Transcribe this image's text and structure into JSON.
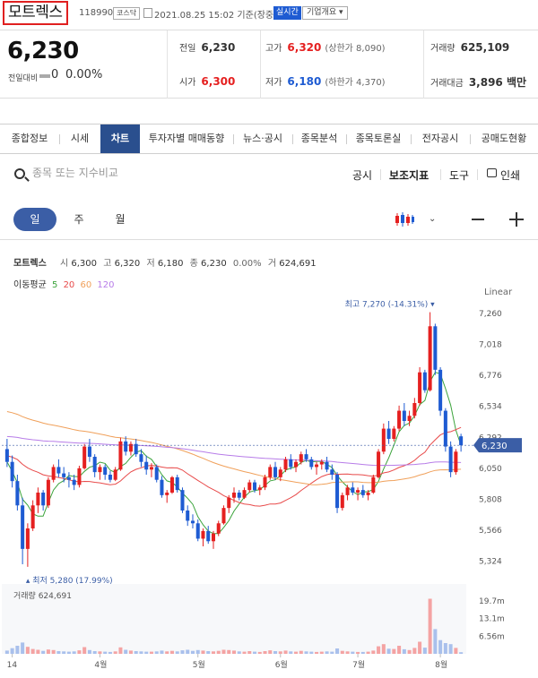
{
  "header": {
    "stock_name": "모트렉스",
    "code": "118990",
    "market": "코스닥",
    "datetime": "2021.08.25 15:02 기준(장중)",
    "realtime": "실시간",
    "company_button": "기업개요 ▾"
  },
  "price": {
    "current": "6,230",
    "change_label": "전일대비",
    "change_value": "0",
    "change_rate": "0.00%"
  },
  "stats": {
    "prev_close_label": "전일",
    "prev_close": "6,230",
    "high_label": "고가",
    "high": "6,320",
    "upper_limit": "(상한가 8,090)",
    "volume_label": "거래량",
    "volume": "625,109",
    "open_label": "시가",
    "open": "6,300",
    "low_label": "저가",
    "low": "6,180",
    "lower_limit": "(하한가 4,370)",
    "amount_label": "거래대금",
    "amount": "3,896 백만"
  },
  "tabs": [
    "종합정보",
    "시세",
    "차트",
    "투자자별 매매동향",
    "뉴스·공시",
    "종목분석",
    "종목토론실",
    "전자공시",
    "공매도현황"
  ],
  "toolbar": {
    "search_placeholder": "종목 또는 지수비교",
    "disclosure": "공시",
    "indicators": "보조지표",
    "tools": "도구",
    "print": "인쇄"
  },
  "periods": [
    "일",
    "주",
    "월"
  ],
  "chart_info": {
    "name": "모트렉스",
    "open_label": "시",
    "open": "6,300",
    "high_label": "고",
    "high": "6,320",
    "low_label": "저",
    "low": "6,180",
    "close_label": "종",
    "close": "6,230",
    "rate": "0.00%",
    "volume_label": "거",
    "volume": "624,691",
    "ma_label": "이동평균",
    "ma5": "5",
    "ma20": "20",
    "ma60": "60",
    "ma120": "120",
    "scale": "Linear"
  },
  "colors": {
    "up": "#e52020",
    "down": "#1e5bd2",
    "ma5": "#3aa33a",
    "ma20": "#e84a4a",
    "ma60": "#f0a05a",
    "ma120": "#b77ce8",
    "accent": "#2a4f8e"
  },
  "chart_data": {
    "type": "candlestick",
    "x_labels": [
      "14",
      "4월",
      "5월",
      "6월",
      "7월",
      "8월"
    ],
    "y_ticks": [
      "7,260",
      "7,018",
      "6,776",
      "6,534",
      "6,292",
      "6,050",
      "5,808",
      "5,566",
      "5,324"
    ],
    "y_range": [
      5230,
      7330
    ],
    "current_price": 6230,
    "current_price_label": "6,230",
    "max_label": "최고 7,270 (-14.31%)",
    "min_label": "최저 5,280 (17.99%)",
    "volume_label": "거래량",
    "volume_value": "624,691",
    "volume_ticks": [
      "19.7m",
      "13.1m",
      "6.56m"
    ],
    "volume_max": 26000000,
    "candles": [
      [
        6200,
        6280,
        6060,
        6100
      ],
      [
        6100,
        6150,
        5900,
        5950
      ],
      [
        5950,
        6000,
        5720,
        5760
      ],
      [
        5760,
        5820,
        5300,
        5420
      ],
      [
        5420,
        5620,
        5280,
        5580
      ],
      [
        5580,
        5800,
        5560,
        5760
      ],
      [
        5760,
        5900,
        5700,
        5860
      ],
      [
        5860,
        5880,
        5720,
        5760
      ],
      [
        5760,
        5980,
        5740,
        5960
      ],
      [
        5960,
        6080,
        5940,
        6060
      ],
      [
        6060,
        6120,
        5980,
        6010
      ],
      [
        6010,
        6060,
        5940,
        5980
      ],
      [
        5980,
        6020,
        5900,
        5960
      ],
      [
        5960,
        6000,
        5880,
        5920
      ],
      [
        5920,
        6070,
        5900,
        6050
      ],
      [
        6050,
        6240,
        6040,
        6220
      ],
      [
        6220,
        6280,
        6100,
        6140
      ],
      [
        6140,
        6160,
        5980,
        6020
      ],
      [
        6020,
        6080,
        5960,
        6060
      ],
      [
        6060,
        6080,
        5960,
        6000
      ],
      [
        6000,
        6030,
        5940,
        5960
      ],
      [
        5960,
        6060,
        5950,
        6040
      ],
      [
        6040,
        6290,
        6030,
        6260
      ],
      [
        6260,
        6300,
        6150,
        6180
      ],
      [
        6180,
        6260,
        6150,
        6240
      ],
      [
        6240,
        6280,
        6140,
        6160
      ],
      [
        6160,
        6200,
        6060,
        6100
      ],
      [
        6100,
        6150,
        6000,
        6040
      ],
      [
        6040,
        6090,
        5980,
        6060
      ],
      [
        6060,
        6080,
        5940,
        5960
      ],
      [
        5960,
        5990,
        5820,
        5840
      ],
      [
        5840,
        5880,
        5780,
        5860
      ],
      [
        5860,
        5990,
        5850,
        5980
      ],
      [
        5980,
        6000,
        5860,
        5880
      ],
      [
        5880,
        5900,
        5700,
        5720
      ],
      [
        5720,
        5760,
        5600,
        5640
      ],
      [
        5640,
        5690,
        5580,
        5620
      ],
      [
        5620,
        5650,
        5480,
        5500
      ],
      [
        5500,
        5580,
        5440,
        5560
      ],
      [
        5560,
        5600,
        5460,
        5480
      ],
      [
        5480,
        5560,
        5420,
        5540
      ],
      [
        5540,
        5640,
        5520,
        5620
      ],
      [
        5620,
        5760,
        5610,
        5740
      ],
      [
        5740,
        5840,
        5700,
        5820
      ],
      [
        5820,
        5900,
        5780,
        5860
      ],
      [
        5860,
        5880,
        5800,
        5820
      ],
      [
        5820,
        5900,
        5810,
        5880
      ],
      [
        5880,
        5960,
        5860,
        5940
      ],
      [
        5940,
        5960,
        5860,
        5880
      ],
      [
        5880,
        5920,
        5840,
        5900
      ],
      [
        5900,
        6000,
        5880,
        5980
      ],
      [
        5980,
        6080,
        5960,
        6060
      ],
      [
        6060,
        6100,
        5960,
        5980
      ],
      [
        5980,
        6060,
        5950,
        6040
      ],
      [
        6040,
        6140,
        6020,
        6120
      ],
      [
        6120,
        6160,
        6040,
        6060
      ],
      [
        6060,
        6120,
        6020,
        6100
      ],
      [
        6100,
        6180,
        6080,
        6160
      ],
      [
        6160,
        6200,
        6100,
        6120
      ],
      [
        6120,
        6140,
        6040,
        6060
      ],
      [
        6060,
        6100,
        6000,
        6080
      ],
      [
        6080,
        6120,
        6040,
        6100
      ],
      [
        6100,
        6140,
        6020,
        6040
      ],
      [
        6040,
        6080,
        5960,
        6000
      ],
      [
        6000,
        6020,
        5700,
        5740
      ],
      [
        5740,
        5860,
        5720,
        5840
      ],
      [
        5840,
        5920,
        5800,
        5900
      ],
      [
        5900,
        5940,
        5840,
        5860
      ],
      [
        5860,
        5900,
        5800,
        5880
      ],
      [
        5880,
        5920,
        5820,
        5840
      ],
      [
        5840,
        5880,
        5800,
        5860
      ],
      [
        5860,
        6000,
        5850,
        5980
      ],
      [
        5980,
        6200,
        5970,
        6180
      ],
      [
        6180,
        6400,
        6160,
        6360
      ],
      [
        6360,
        6420,
        6240,
        6280
      ],
      [
        6280,
        6380,
        6260,
        6360
      ],
      [
        6360,
        6540,
        6340,
        6500
      ],
      [
        6500,
        6560,
        6380,
        6420
      ],
      [
        6420,
        6500,
        6380,
        6460
      ],
      [
        6460,
        6600,
        6440,
        6560
      ],
      [
        6560,
        6840,
        6540,
        6800
      ],
      [
        6800,
        6820,
        6640,
        6660
      ],
      [
        6660,
        7270,
        6650,
        7160
      ],
      [
        7160,
        7180,
        6780,
        6820
      ],
      [
        6820,
        6840,
        6460,
        6500
      ],
      [
        6500,
        6520,
        6180,
        6220
      ],
      [
        6220,
        6260,
        5980,
        6020
      ],
      [
        6020,
        6200,
        6000,
        6180
      ],
      [
        6300,
        6320,
        6180,
        6230
      ]
    ],
    "volumes": [
      1.2,
      2.1,
      3.0,
      4.2,
      2.6,
      1.8,
      1.5,
      1.1,
      1.6,
      1.4,
      1.0,
      0.9,
      0.8,
      0.9,
      1.3,
      2.5,
      1.4,
      1.0,
      0.9,
      0.8,
      0.7,
      0.9,
      2.4,
      1.5,
      1.2,
      1.0,
      0.9,
      0.8,
      0.8,
      0.9,
      1.2,
      0.9,
      1.1,
      0.9,
      1.3,
      1.5,
      1.1,
      1.4,
      1.2,
      1.0,
      0.9,
      1.1,
      1.5,
      1.4,
      1.2,
      0.9,
      0.8,
      1.0,
      0.8,
      0.7,
      1.0,
      1.3,
      1.0,
      0.9,
      1.2,
      0.9,
      0.8,
      1.1,
      0.9,
      0.8,
      0.7,
      0.8,
      0.9,
      0.8,
      2.0,
      1.1,
      0.9,
      0.8,
      0.7,
      0.7,
      0.8,
      1.2,
      2.8,
      3.6,
      1.9,
      1.8,
      3.0,
      1.7,
      1.4,
      2.2,
      4.5,
      2.3,
      20.5,
      9.2,
      5.1,
      4.0,
      3.6,
      2.2,
      0.6
    ]
  }
}
